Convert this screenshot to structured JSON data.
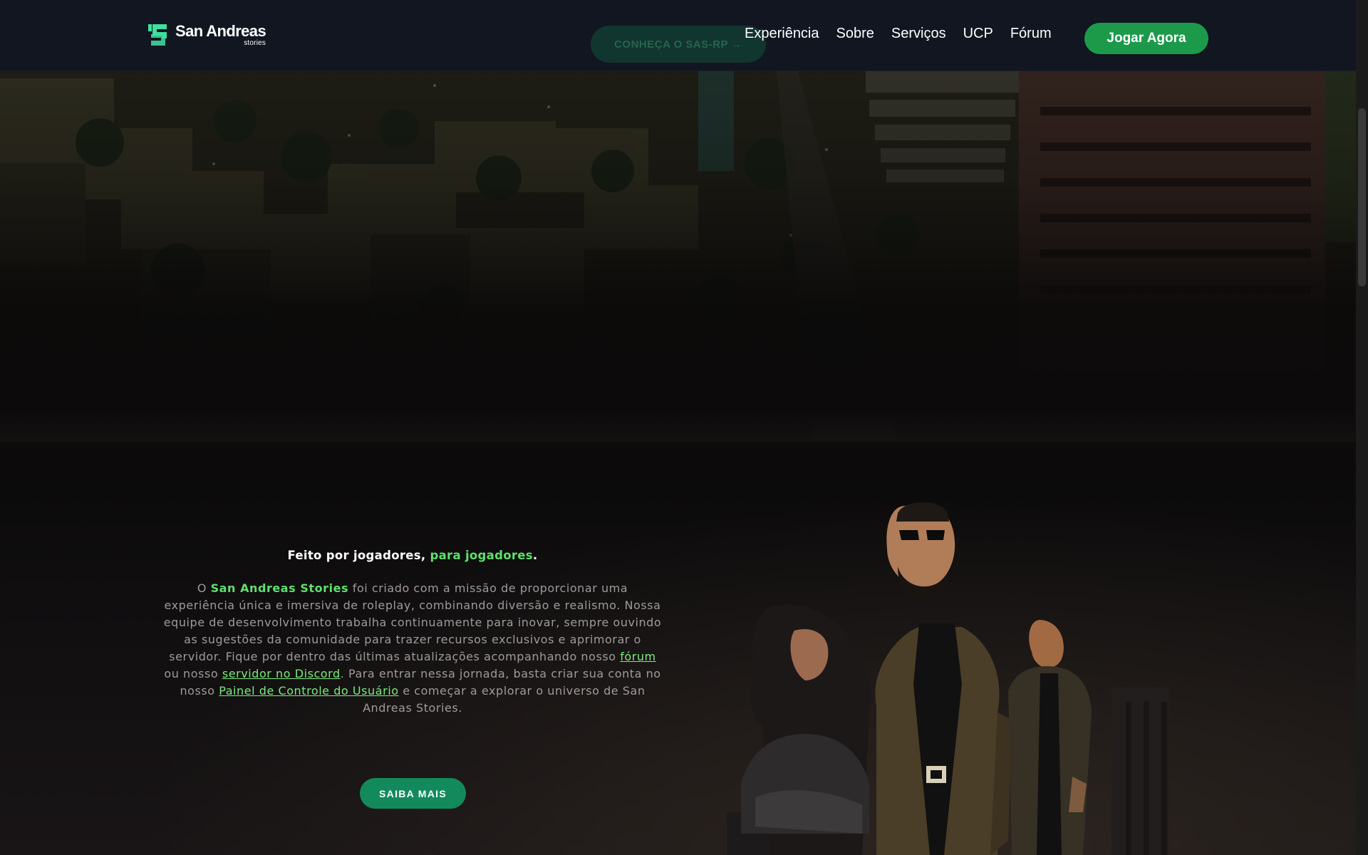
{
  "brand": {
    "name": "San Andreas",
    "subtitle": "stories",
    "logo_color": "#3fe0a0"
  },
  "navbar": {
    "ghost_cta_label": "CONHEÇA O SAS-RP →",
    "links": [
      {
        "label": "Experiência"
      },
      {
        "label": "Sobre"
      },
      {
        "label": "Serviços"
      },
      {
        "label": "UCP"
      },
      {
        "label": "Fórum"
      }
    ],
    "play_label": "Jogar Agora"
  },
  "about": {
    "tagline_start": "Feito por jogadores, ",
    "tagline_accent": "para jogadores",
    "tagline_end": ".",
    "p_prefix": "O ",
    "p_brand": "San Andreas Stories",
    "p_text1": " foi criado com a missão de proporcionar uma experiência única e imersiva de roleplay, combinando diversão e realismo. Nossa equipe de desenvolvimento trabalha continuamente para inovar, sempre ouvindo as sugestões da comunidade para trazer recursos exclusivos e aprimorar o servidor. Fique por dentro das últimas atualizações acompanhando nosso ",
    "link_forum": "fórum",
    "p_text2": " ou nosso ",
    "link_discord": "servidor no Discord",
    "p_text3": ". Para entrar nessa jornada, basta criar sua conta no nosso ",
    "link_ucp": "Painel de Controle do Usuário",
    "p_text4": " e começar a explorar o universo de San Andreas Stories.",
    "button_label": "SAIBA MAIS"
  },
  "colors": {
    "accent_green": "#5ee06c",
    "button_green": "#1c9a4a",
    "saiba_green": "#138a5c",
    "navbar_bg": "#111622"
  }
}
